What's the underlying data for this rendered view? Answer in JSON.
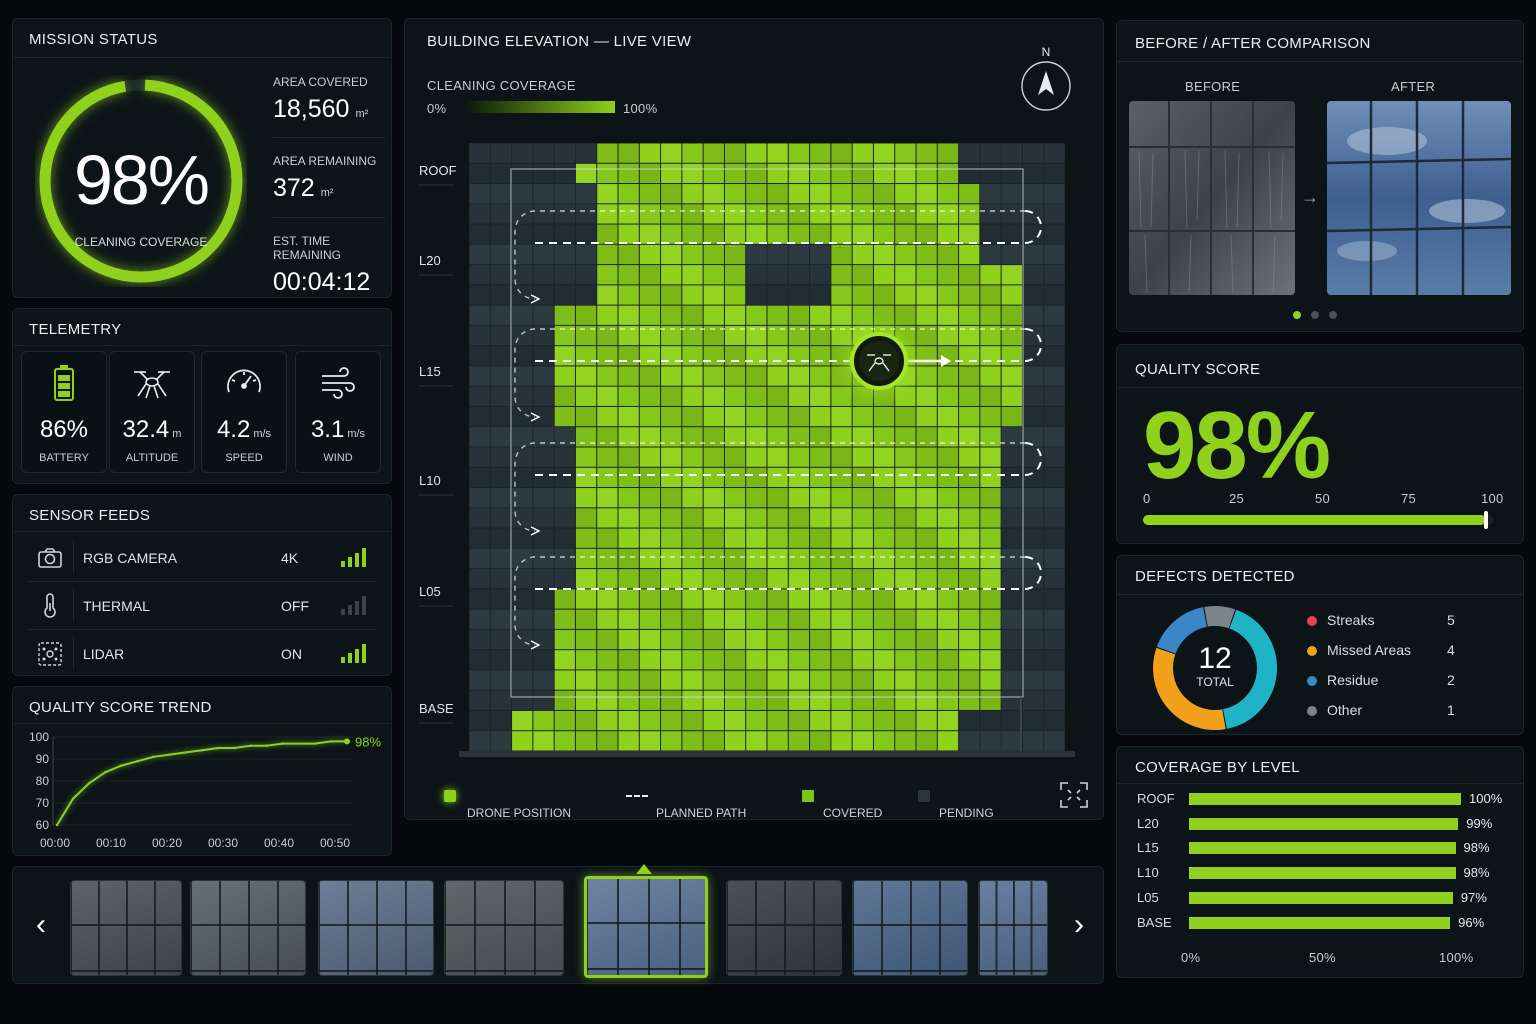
{
  "mission": {
    "title": "MISSION STATUS",
    "coverage_pct": 98,
    "coverage_text": "98%",
    "coverage_label": "CLEANING COVERAGE",
    "area_covered_label": "AREA COVERED",
    "area_covered_value": "18,560",
    "area_covered_unit": "m²",
    "area_remaining_label": "AREA REMAINING",
    "area_remaining_value": "372",
    "area_remaining_unit": "m²",
    "eta_label": "EST. TIME REMAINING",
    "eta_value": "00:04:12"
  },
  "telemetry": {
    "title": "TELEMETRY",
    "items": [
      {
        "icon": "battery-icon",
        "value": "86%",
        "unit": "",
        "label": "BATTERY"
      },
      {
        "icon": "drone-icon",
        "value": "32.4",
        "unit": "m",
        "label": "ALTITUDE"
      },
      {
        "icon": "speedometer-icon",
        "value": "4.2",
        "unit": "m/s",
        "label": "SPEED"
      },
      {
        "icon": "wind-icon",
        "value": "3.1",
        "unit": "m/s",
        "label": "WIND"
      }
    ]
  },
  "sensors": {
    "title": "SENSOR FEEDS",
    "items": [
      {
        "icon": "camera-icon",
        "name": "RGB CAMERA",
        "value": "4K",
        "active": true
      },
      {
        "icon": "thermometer-icon",
        "name": "THERMAL",
        "value": "OFF",
        "active": false
      },
      {
        "icon": "lidar-icon",
        "name": "LIDAR",
        "value": "ON",
        "active": true
      }
    ]
  },
  "trend": {
    "title": "QUALITY SCORE TREND",
    "end_label": "98%"
  },
  "chart_data": {
    "type": "line",
    "title": "QUALITY SCORE TREND",
    "x": [
      "00:00",
      "00:04",
      "00:08",
      "00:12",
      "00:16",
      "00:20",
      "00:24",
      "00:28",
      "00:32",
      "00:36",
      "00:40",
      "00:44",
      "00:48",
      "00:50",
      "00:52",
      "00:54",
      "00:56",
      "00:58",
      "01:00"
    ],
    "values": [
      60,
      72,
      79,
      84,
      87,
      89,
      91,
      92,
      93,
      94,
      95,
      95,
      96,
      96,
      97,
      97,
      97,
      98,
      98
    ],
    "x_ticks": [
      "00:00",
      "00:10",
      "00:20",
      "00:30",
      "00:40",
      "00:50"
    ],
    "y_ticks": [
      "100",
      "90",
      "80",
      "70",
      "60"
    ],
    "ylim": [
      60,
      100
    ],
    "color": "#8fd11c"
  },
  "elevation": {
    "title": "BUILDING ELEVATION — LIVE VIEW",
    "coverage_label": "CLEANING COVERAGE",
    "scale_min": "0%",
    "scale_max": "100%",
    "compass": "N",
    "levels": [
      "ROOF",
      "L20",
      "L15",
      "L10",
      "L05",
      "BASE"
    ],
    "legend": {
      "drone": "DRONE POSITION",
      "path": "PLANNED PATH",
      "covered": "COVERED",
      "pending": "PENDING"
    }
  },
  "comparison": {
    "title": "BEFORE / AFTER COMPARISON",
    "before": "BEFORE",
    "after": "AFTER",
    "pages": 3,
    "active_page": 1
  },
  "quality": {
    "title": "QUALITY SCORE",
    "value_text": "98%",
    "value": 98,
    "ticks": [
      "0",
      "25",
      "50",
      "75",
      "100"
    ]
  },
  "defects": {
    "title": "DEFECTS DETECTED",
    "total": "12",
    "total_label": "TOTAL",
    "items": [
      {
        "name": "Streaks",
        "count": "5",
        "value": 5,
        "color": "#1fb3c6"
      },
      {
        "name": "Missed Areas",
        "count": "4",
        "value": 4,
        "color": "#f0a01a"
      },
      {
        "name": "Residue",
        "count": "2",
        "value": 2,
        "color": "#3a86c8"
      },
      {
        "name": "Other",
        "count": "1",
        "value": 1,
        "color": "#7b8589"
      }
    ]
  },
  "levels_cov": {
    "title": "COVERAGE BY LEVEL",
    "items": [
      {
        "name": "ROOF",
        "pct": 100,
        "text": "100%"
      },
      {
        "name": "L20",
        "pct": 99,
        "text": "99%"
      },
      {
        "name": "L15",
        "pct": 98,
        "text": "98%"
      },
      {
        "name": "L10",
        "pct": 98,
        "text": "98%"
      },
      {
        "name": "L05",
        "pct": 97,
        "text": "97%"
      },
      {
        "name": "BASE",
        "pct": 96,
        "text": "96%"
      }
    ],
    "axis": [
      "0%",
      "50%",
      "100%"
    ]
  },
  "gallery": {
    "prev": "‹",
    "next": "›",
    "active_index": 4
  }
}
